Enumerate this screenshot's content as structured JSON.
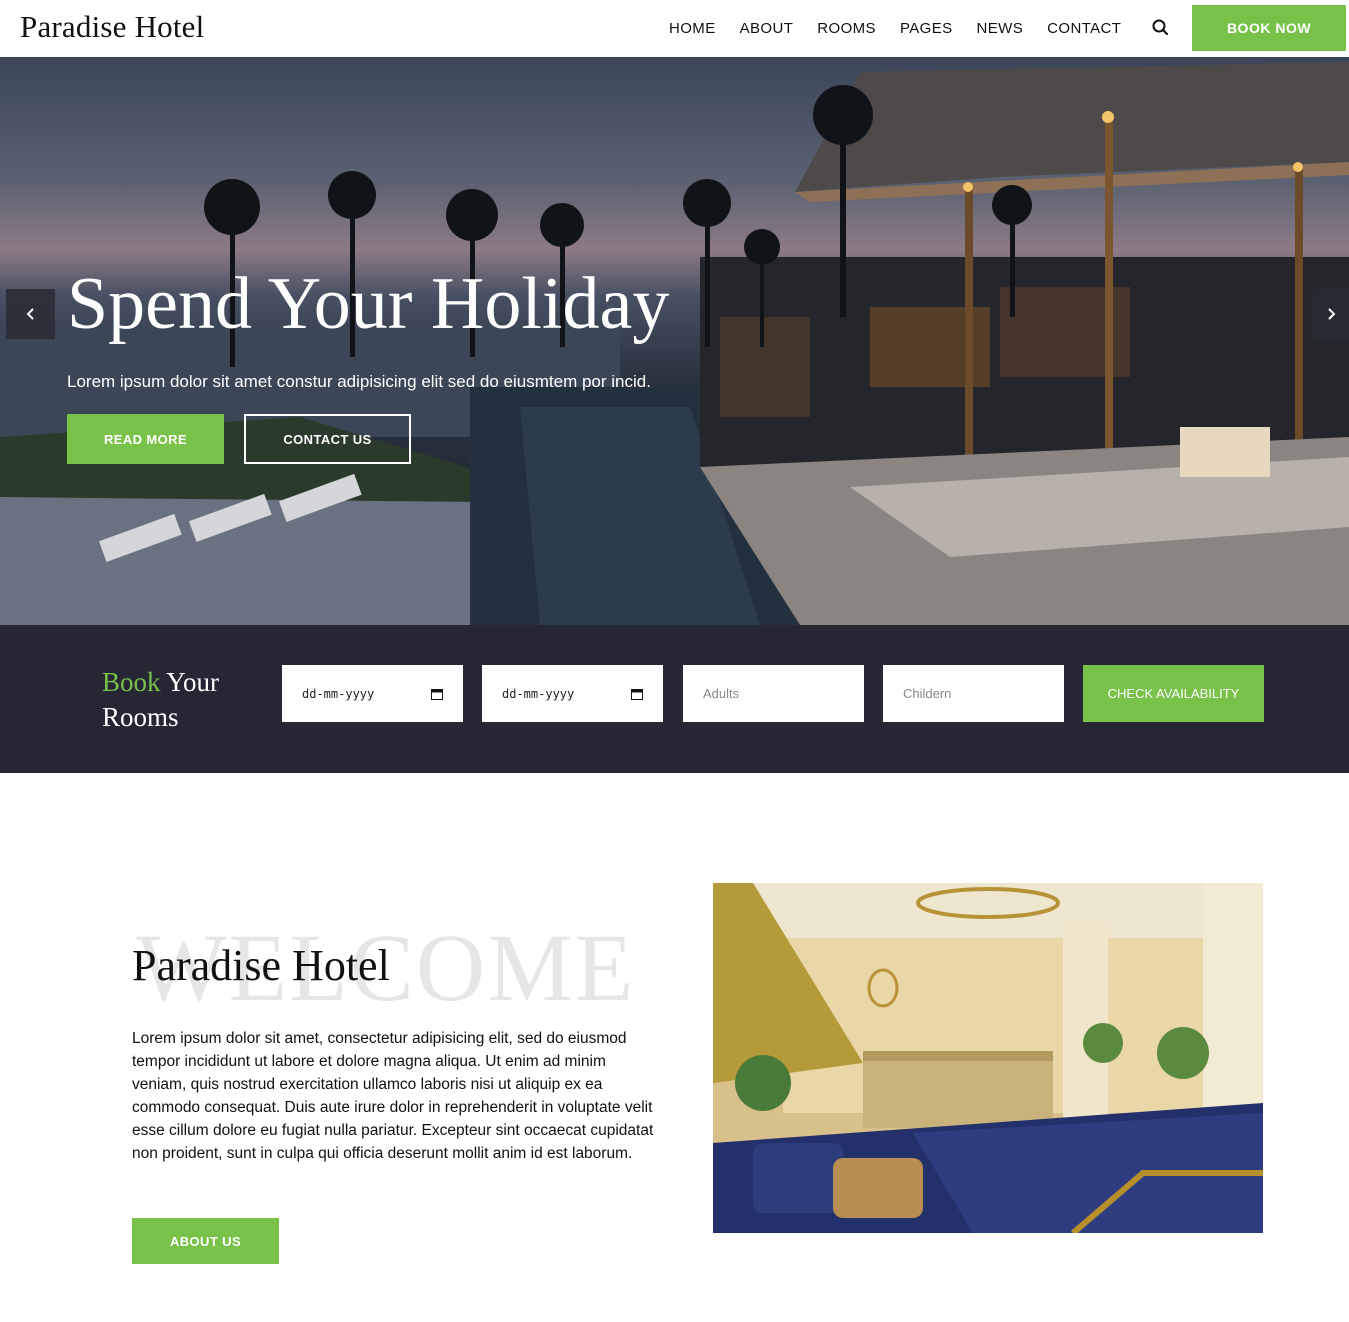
{
  "header": {
    "logo": "Paradise Hotel",
    "nav": [
      "HOME",
      "ABOUT",
      "ROOMS",
      "PAGES",
      "NEWS",
      "CONTACT"
    ],
    "book_now": "BOOK NOW"
  },
  "hero": {
    "title": "Spend Your Holiday",
    "subtitle": "Lorem ipsum dolor sit amet constur adipisicing elit sed do eiusmtem por incid.",
    "read_more": "READ MORE",
    "contact_us": "CONTACT US"
  },
  "booking": {
    "title_highlight": "Book",
    "title_rest_1": "Your",
    "title_rest_2": "Rooms",
    "checkin_value": "dd-mm-yyyy",
    "checkout_value": "dd-mm-yyyy",
    "adults_placeholder": "Adults",
    "children_placeholder": "Childern",
    "check_button": "CHECK AVAILABILITY"
  },
  "welcome": {
    "background_word": "WELCOME",
    "title": "Paradise Hotel",
    "text": "Lorem ipsum dolor sit amet, consectetur adipisicing elit, sed do eiusmod tempor incididunt ut labore et dolore magna aliqua. Ut enim ad minim veniam, quis nostrud exercitation ullamco laboris nisi ut aliquip ex ea commodo consequat. Duis aute irure dolor in reprehenderit in voluptate velit esse cillum dolore eu fugiat nulla pariatur. Excepteur sint occaecat cupidatat non proident, sunt in culpa qui officia deserunt mollit anim id est laborum.",
    "about_button": "ABOUT US"
  },
  "colors": {
    "accent": "#78c24a",
    "booking_bar": "#262635"
  },
  "icons": [
    "search-icon",
    "chevron-left-icon",
    "chevron-right-icon",
    "calendar-icon"
  ]
}
